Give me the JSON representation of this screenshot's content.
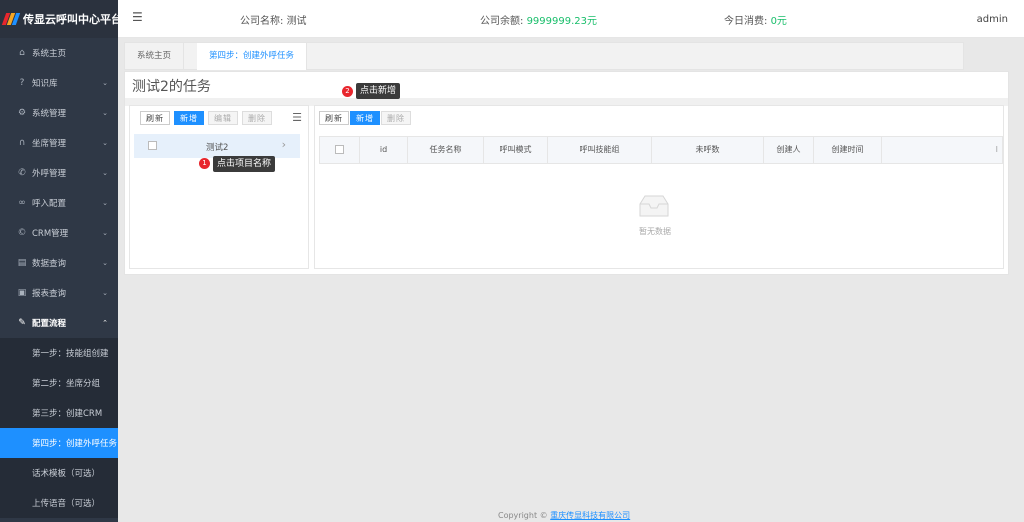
{
  "sidebar": {
    "logo_title": "传显云呼叫中心平台",
    "logo_colors": [
      "#e8262d",
      "#f5a623",
      "#1e90ff"
    ],
    "items": [
      {
        "label": "系统主页",
        "icon": "home-icon"
      },
      {
        "label": "知识库",
        "icon": "question-icon"
      },
      {
        "label": "系统管理",
        "icon": "gear-icon"
      },
      {
        "label": "坐席管理",
        "icon": "headset-icon"
      },
      {
        "label": "外呼管理",
        "icon": "phone-icon"
      },
      {
        "label": "呼入配置",
        "icon": "link-icon"
      },
      {
        "label": "CRM管理",
        "icon": "copyright-icon"
      },
      {
        "label": "数据查询",
        "icon": "document-icon"
      },
      {
        "label": "报表查询",
        "icon": "report-icon"
      },
      {
        "label": "配置流程",
        "icon": "wrench-icon"
      }
    ],
    "sub_items": [
      {
        "label": "第一步：技能组创建"
      },
      {
        "label": "第二步：坐席分组"
      },
      {
        "label": "第三步：创建CRM"
      },
      {
        "label": "第四步：创建外呼任务"
      },
      {
        "label": "话术模板（可选）"
      },
      {
        "label": "上传语音（可选）"
      }
    ]
  },
  "header": {
    "company_label": "公司名称:",
    "company_value": "测试",
    "balance_label": "公司余额:",
    "balance_value": "9999999.23元",
    "spend_label": "今日消费:",
    "spend_value": "0元",
    "user": "admin"
  },
  "tabs": [
    {
      "label": "系统主页"
    },
    {
      "label": "第四步：创建外呼任务"
    }
  ],
  "panel": {
    "title": "测试2的任务"
  },
  "left": {
    "buttons": {
      "refresh": "刷新",
      "add": "新增",
      "edit": "编辑",
      "delete": "删除"
    },
    "tree_item": "测试2"
  },
  "right": {
    "buttons": {
      "refresh": "刷新",
      "add": "新增",
      "delete": "删除"
    },
    "columns": [
      "id",
      "任务名称",
      "呼叫模式",
      "呼叫技能组",
      "未呼数",
      "创建人",
      "创建时间"
    ],
    "empty_text": "暂无数据"
  },
  "tips": [
    {
      "num": "1",
      "text": "点击项目名称"
    },
    {
      "num": "2",
      "text": "点击新增"
    }
  ],
  "footer": {
    "prefix": "Copyright",
    "company": "重庆传显科技有限公司"
  }
}
